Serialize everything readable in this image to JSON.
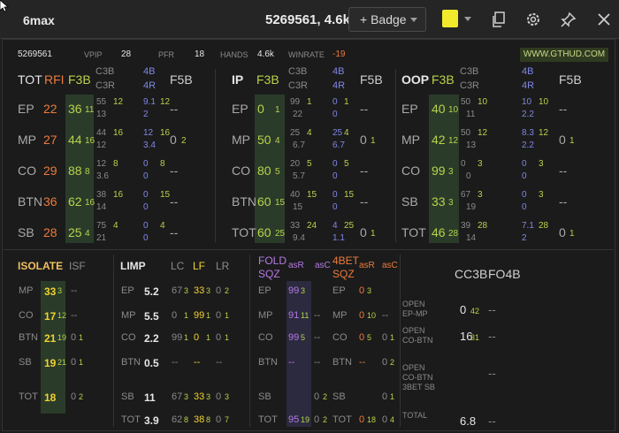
{
  "window": {
    "title": "6max",
    "player": "5269561, 4.6k",
    "badge_label": "+ Badge",
    "swatch_color": "#f2ea2a"
  },
  "summary": {
    "id": "5269561",
    "vpip_label": "VPIP",
    "vpip": "28",
    "pfr_label": "PFR",
    "pfr": "18",
    "hands_label": "HANDS",
    "hands": "4.6k",
    "winrate_label": "WINRATE",
    "winrate": "-19",
    "site": "WWW.GTHUD.COM"
  },
  "sec1": {
    "h_tot": "TOT",
    "h_rfi": "RFI",
    "h_f3b": "F3B",
    "h_c3b": "C3B",
    "h_c3r": "C3R",
    "h_4b": "4B",
    "h_4r": "4R",
    "h_f5b": "F5B",
    "rows": [
      {
        "pos": "EP",
        "rfi": "22",
        "f3b": "36",
        "f3b_n": "11",
        "c3b": "55",
        "c3b_n": "12",
        "c3r": "13",
        "b4": "9.1",
        "b4_n": "12",
        "r4": "2",
        "f5b": "--",
        "f5b_n": ""
      },
      {
        "pos": "MP",
        "rfi": "27",
        "f3b": "44",
        "f3b_n": "16",
        "c3b": "44",
        "c3b_n": "16",
        "c3r": "12",
        "b4": "12",
        "b4_n": "16",
        "r4": "3.4",
        "f5b": "0",
        "f5b_n": "2"
      },
      {
        "pos": "CO",
        "rfi": "29",
        "f3b": "88",
        "f3b_n": "8",
        "c3b": "12",
        "c3b_n": "8",
        "c3r": "3.6",
        "b4": "0",
        "b4_n": "8",
        "r4": "0",
        "f5b": "--",
        "f5b_n": ""
      },
      {
        "pos": "BTN",
        "rfi": "36",
        "f3b": "62",
        "f3b_n": "16",
        "c3b": "38",
        "c3b_n": "16",
        "c3r": "14",
        "b4": "0",
        "b4_n": "15",
        "r4": "0",
        "f5b": "--",
        "f5b_n": ""
      },
      {
        "pos": "SB",
        "rfi": "28",
        "f3b": "25",
        "f3b_n": "4",
        "c3b": "75",
        "c3b_n": "4",
        "c3r": "21",
        "b4": "0",
        "b4_n": "4",
        "r4": "0",
        "f5b": "--",
        "f5b_n": ""
      }
    ]
  },
  "sec2": {
    "h_ip": "IP",
    "h_f3b": "F3B",
    "h_c3b": "C3B",
    "h_c3r": "C3R",
    "h_4b": "4B",
    "h_4r": "4R",
    "h_f5b": "F5B",
    "rows": [
      {
        "pos": "EP",
        "f3b": "0",
        "f3b_n": "1",
        "c3b": "99",
        "c3b_n": "1",
        "c3r": "22",
        "b4": "0",
        "b4_n": "1",
        "r4": "0",
        "f5b": "--",
        "f5b_n": ""
      },
      {
        "pos": "MP",
        "f3b": "50",
        "f3b_n": "4",
        "c3b": "25",
        "c3b_n": "4",
        "c3r": "6.7",
        "b4": "25",
        "b4_n": "4",
        "r4": "6.7",
        "f5b": "0",
        "f5b_n": "1"
      },
      {
        "pos": "CO",
        "f3b": "80",
        "f3b_n": "5",
        "c3b": "20",
        "c3b_n": "5",
        "c3r": "5.7",
        "b4": "0",
        "b4_n": "5",
        "r4": "0",
        "f5b": "--",
        "f5b_n": ""
      },
      {
        "pos": "BTN",
        "f3b": "60",
        "f3b_n": "15",
        "c3b": "40",
        "c3b_n": "15",
        "c3r": "15",
        "b4": "0",
        "b4_n": "15",
        "r4": "0",
        "f5b": "--",
        "f5b_n": ""
      },
      {
        "pos": "TOT",
        "f3b": "60",
        "f3b_n": "25",
        "c3b": "33",
        "c3b_n": "24",
        "c3r": "9.4",
        "b4": "4",
        "b4_n": "25",
        "r4": "1.1",
        "f5b": "0",
        "f5b_n": "1"
      }
    ]
  },
  "sec3": {
    "h_oop": "OOP",
    "h_f3b": "F3B",
    "h_c3b": "C3B",
    "h_c3r": "C3R",
    "h_4b": "4B",
    "h_4r": "4R",
    "h_f5b": "F5B",
    "rows": [
      {
        "pos": "EP",
        "f3b": "40",
        "f3b_n": "10",
        "c3b": "50",
        "c3b_n": "10",
        "c3r": "11",
        "b4": "10",
        "b4_n": "10",
        "r4": "2.2",
        "f5b": "--",
        "f5b_n": ""
      },
      {
        "pos": "MP",
        "f3b": "42",
        "f3b_n": "12",
        "c3b": "50",
        "c3b_n": "12",
        "c3r": "13",
        "b4": "8.3",
        "b4_n": "12",
        "r4": "2.2",
        "f5b": "0",
        "f5b_n": "1"
      },
      {
        "pos": "CO",
        "f3b": "99",
        "f3b_n": "3",
        "c3b": "0",
        "c3b_n": "3",
        "c3r": "0",
        "b4": "0",
        "b4_n": "3",
        "r4": "0",
        "f5b": "--",
        "f5b_n": ""
      },
      {
        "pos": "SB",
        "f3b": "33",
        "f3b_n": "3",
        "c3b": "67",
        "c3b_n": "3",
        "c3r": "19",
        "b4": "0",
        "b4_n": "3",
        "r4": "0",
        "f5b": "--",
        "f5b_n": ""
      },
      {
        "pos": "TOT",
        "f3b": "46",
        "f3b_n": "28",
        "c3b": "39",
        "c3b_n": "28",
        "c3r": "14",
        "b4": "7.1",
        "b4_n": "28",
        "r4": "2",
        "f5b": "0",
        "f5b_n": "1"
      }
    ]
  },
  "isolate": {
    "h_iso": "ISOLATE",
    "h_isf": "ISF",
    "rows": [
      {
        "pos": "MP",
        "v": "33",
        "n": "3",
        "isf": "--",
        "isf_n": ""
      },
      {
        "pos": "CO",
        "v": "17",
        "n": "12",
        "isf": "--",
        "isf_n": ""
      },
      {
        "pos": "BTN",
        "v": "21",
        "n": "19",
        "isf": "0",
        "isf_n": "1"
      },
      {
        "pos": "SB",
        "v": "19",
        "n": "21",
        "isf": "0",
        "isf_n": "1"
      },
      {
        "pos": "TOT",
        "v": "18",
        "n": "",
        "isf": "0",
        "isf_n": "2"
      }
    ]
  },
  "limp": {
    "h_limp": "LIMP",
    "h_lc": "LC",
    "h_lf": "LF",
    "h_lr": "LR",
    "rows": [
      {
        "pos": "EP",
        "v": "5.2",
        "lc": "67",
        "lc_n": "3",
        "lf": "33",
        "lf_n": "3",
        "lr": "0",
        "lr_n": "2"
      },
      {
        "pos": "MP",
        "v": "5.5",
        "lc": "0",
        "lc_n": "1",
        "lf": "99",
        "lf_n": "1",
        "lr": "0",
        "lr_n": "1"
      },
      {
        "pos": "CO",
        "v": "2.2",
        "lc": "99",
        "lc_n": "1",
        "lf": "0",
        "lf_n": "1",
        "lr": "0",
        "lr_n": "1"
      },
      {
        "pos": "BTN",
        "v": "0.5",
        "lc": "--",
        "lc_n": "",
        "lf": "--",
        "lf_n": "",
        "lr": "--",
        "lr_n": ""
      },
      {
        "pos": "SB",
        "v": "11",
        "lc": "67",
        "lc_n": "3",
        "lf": "33",
        "lf_n": "3",
        "lr": "0",
        "lr_n": "3"
      },
      {
        "pos": "TOT",
        "v": "3.9",
        "lc": "62",
        "lc_n": "8",
        "lf": "38",
        "lf_n": "8",
        "lr": "0",
        "lr_n": "7"
      }
    ]
  },
  "foldsqz": {
    "h_fold": "FOLD",
    "h_sqz": "SQZ",
    "h_asr": "asR",
    "h_asc": "asC",
    "h_4bet": "4BET",
    "h_sqz2": "SQZ",
    "h_asr2": "asR",
    "h_asc2": "asC",
    "rows": [
      {
        "pos": "EP",
        "a": "99",
        "a_n": "3",
        "b": "",
        "b_n": "",
        "pos2": "EP",
        "c": "0",
        "c_n": "3",
        "d": "",
        "d_n": ""
      },
      {
        "pos": "MP",
        "a": "91",
        "a_n": "11",
        "b": "--",
        "b_n": "",
        "pos2": "MP",
        "c": "0",
        "c_n": "10",
        "d": "--",
        "d_n": ""
      },
      {
        "pos": "CO",
        "a": "99",
        "a_n": "5",
        "b": "--",
        "b_n": "",
        "pos2": "CO",
        "c": "0",
        "c_n": "5",
        "d": "0",
        "d_n": "1"
      },
      {
        "pos": "BTN",
        "a": "--",
        "a_n": "",
        "b": "--",
        "b_n": "",
        "pos2": "BTN",
        "c": "--",
        "c_n": "",
        "d": "0",
        "d_n": "2"
      },
      {
        "pos": "SB",
        "a": "",
        "a_n": "",
        "b": "0",
        "b_n": "2",
        "pos2": "SB",
        "c": "",
        "c_n": "",
        "d": "0",
        "d_n": "1"
      },
      {
        "pos": "TOT",
        "a": "95",
        "a_n": "19",
        "b": "0",
        "b_n": "2",
        "pos2": "TOT",
        "c": "0",
        "c_n": "18",
        "d": "0",
        "d_n": "4"
      }
    ]
  },
  "cc3b": {
    "h_cc3b": "CC3B",
    "h_fo4b": "FO4B",
    "rows": [
      {
        "l1": "OPEN",
        "l2": "EP-MP",
        "l3": "",
        "v": "0",
        "n": "42",
        "f": "--"
      },
      {
        "l1": "OPEN",
        "l2": "CO-BTN",
        "l3": "",
        "v": "16",
        "n": "31",
        "f": "--"
      },
      {
        "l1": "OPEN",
        "l2": "CO-BTN",
        "l3": "3BET SB",
        "v": "",
        "n": "",
        "f": "--"
      },
      {
        "l1": "TOTAL",
        "l2": "",
        "l3": "",
        "v": "6.8",
        "n": "",
        "f": "--"
      }
    ]
  }
}
